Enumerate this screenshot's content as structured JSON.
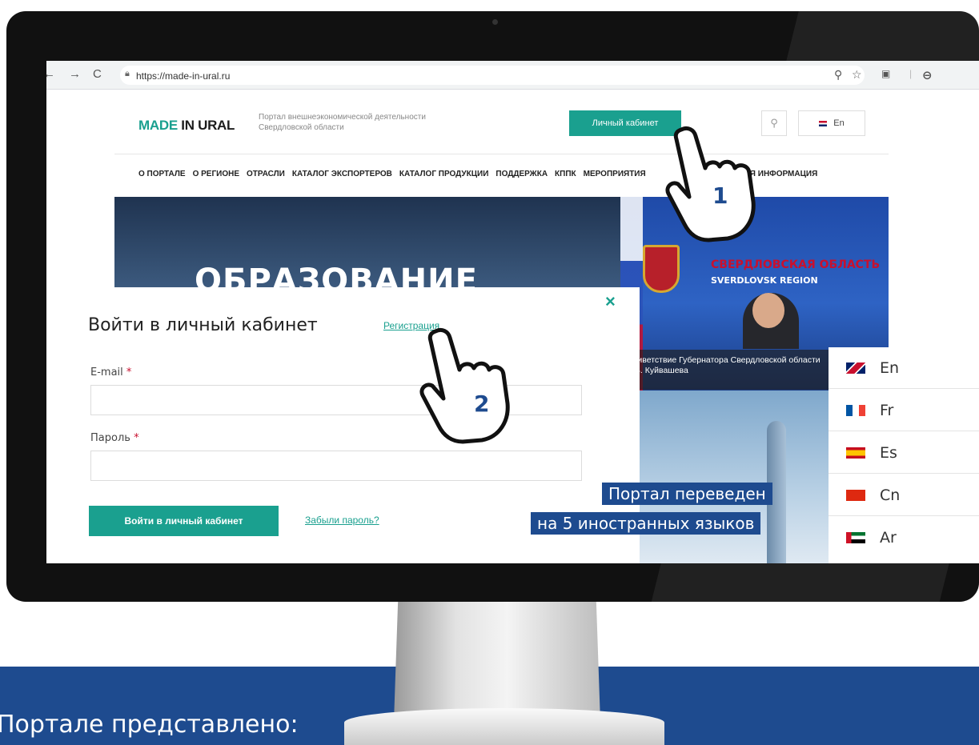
{
  "browser": {
    "url": "https://made-in-ural.ru"
  },
  "site": {
    "logo_accent": "MADE",
    "logo_rest": " IN URAL",
    "tagline": "Портал внешнеэкономической деятельности Свердловской области",
    "cabinet_button": "Личный кабинет",
    "lang_button": "En",
    "menu": [
      "О ПОРТАЛЕ",
      "О РЕГИОНЕ",
      "ОТРАСЛИ",
      "КАТАЛОГ ЭКСПОРТЕРОВ",
      "КАТАЛОГ ПРОДУКЦИИ",
      "ПОДДЕРЖКА",
      "КППК",
      "МЕРОПРИЯТИЯ",
      "ПОЛЕЗНАЯ ИНФОРМАЦИЯ"
    ]
  },
  "hero": {
    "title": "ОБРАЗОВАНИЕ",
    "region_title": "СВЕРДЛОВСКАЯ ОБЛАСТЬ",
    "region_subtitle": "SVERDLOVSK REGION",
    "news_caption": "Приветствие Губернатора Свердловской области Е.В. Куйвашева"
  },
  "login_modal": {
    "title": "Войти в личный кабинет",
    "register_link": "Регистрация",
    "email_label": "E-mail",
    "password_label": "Пароль",
    "required_mark": "*",
    "submit_button": "Войти в личный кабинет",
    "forgot_link": "Забыли пароль?",
    "close_symbol": "×"
  },
  "callout": {
    "line1": "Портал переведен",
    "line2": "на 5 иностранных языков"
  },
  "languages": [
    {
      "label": "En",
      "flag": "uk-flag-icon"
    },
    {
      "label": "Fr",
      "flag": "france-flag-icon"
    },
    {
      "label": "Es",
      "flag": "spain-flag-icon"
    },
    {
      "label": "Cn",
      "flag": "china-flag-icon"
    },
    {
      "label": "Ar",
      "flag": "uae-flag-icon"
    }
  ],
  "pointers": {
    "first": "1",
    "second": "2"
  },
  "bottom_text": "Портале представлено:",
  "colors": {
    "accent": "#1aa08f",
    "brand_blue": "#1e4b8f"
  }
}
